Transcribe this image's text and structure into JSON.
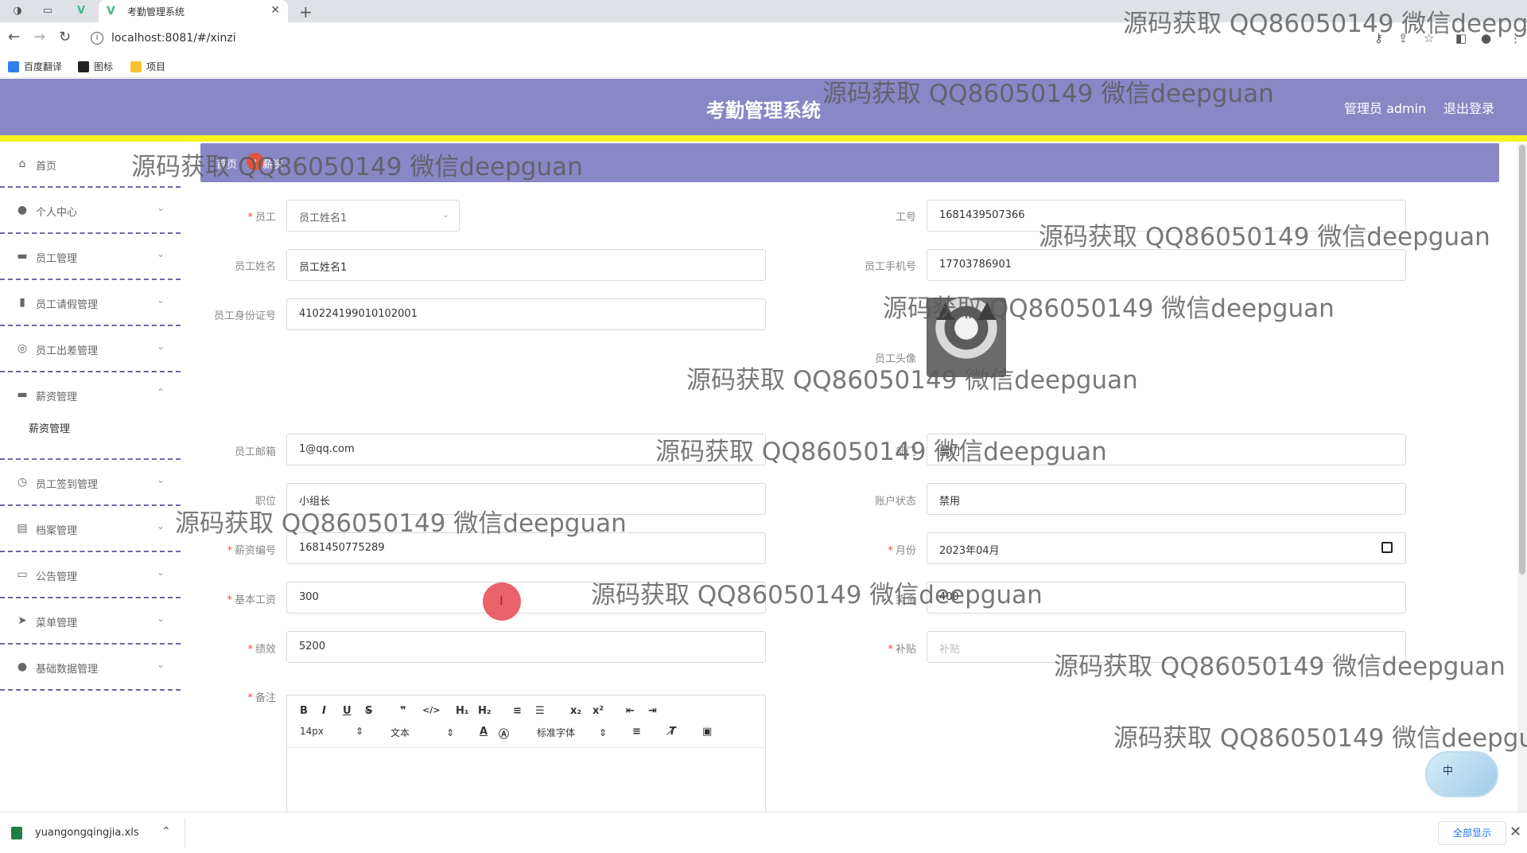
{
  "browser": {
    "tab_title": "考勤管理系统",
    "url": "localhost:8081/#/xinzi",
    "bookmarks": [
      "百度翻译",
      "图标",
      "项目"
    ]
  },
  "header": {
    "title": "考勤管理系统",
    "user": "管理员 admin",
    "logout": "退出登录",
    "accent": "#8a87c6",
    "stripe": "#f5f11e"
  },
  "sidebar": {
    "items": [
      {
        "label": "首页",
        "icon": "home-icon"
      },
      {
        "label": "个人中心",
        "icon": "user-icon"
      },
      {
        "label": "员工管理",
        "icon": "briefcase-icon"
      },
      {
        "label": "员工请假管理",
        "icon": "bar-chart-icon"
      },
      {
        "label": "员工出差管理",
        "icon": "globe-icon"
      },
      {
        "label": "薪资管理",
        "icon": "suitcase-icon"
      },
      {
        "label": "员工签到管理",
        "icon": "clock-icon"
      },
      {
        "label": "档案管理",
        "icon": "archive-icon"
      },
      {
        "label": "公告管理",
        "icon": "monitor-icon"
      },
      {
        "label": "菜单管理",
        "icon": "send-icon"
      },
      {
        "label": "基础数据管理",
        "icon": "user-icon"
      }
    ],
    "sub_item": "薪资管理"
  },
  "breadcrumb": {
    "home": "首页",
    "current": "薪资"
  },
  "form": {
    "employee_label": "员工",
    "employee_value": "员工姓名1",
    "job_no_label": "工号",
    "job_no_value": "1681439507366",
    "name_label": "员工姓名",
    "name_value": "员工姓名1",
    "phone_label": "员工手机号",
    "phone_value": "17703786901",
    "id_label": "员工身份证号",
    "id_value": "410224199010102001",
    "avatar_label": "员工头像",
    "email_label": "员工邮箱",
    "email_value": "1@qq.com",
    "dept_label": "部门",
    "dept_value": "部门",
    "position_label": "职位",
    "position_value": "小组长",
    "account_label": "账户状态",
    "account_value": "禁用",
    "salary_no_label": "薪资编号",
    "salary_no_value": "1681450775289",
    "month_label": "月份",
    "month_value": "2023年04月",
    "base_label": "基本工资",
    "base_value": "300",
    "bonus_label": "奖金",
    "bonus_value": "400",
    "perf_label": "绩效",
    "perf_value": "5200",
    "subsidy_label": "补贴",
    "subsidy_placeholder": "补贴",
    "remark_label": "备注"
  },
  "editor": {
    "font_size": "14px",
    "block": "文本",
    "font_family": "标准字体"
  },
  "ime": {
    "label": "中"
  },
  "downloads": {
    "file": "yuangongqingjia.xls",
    "show_all": "全部显示"
  },
  "watermark": "源码获取 QQ86050149 微信deepguan"
}
